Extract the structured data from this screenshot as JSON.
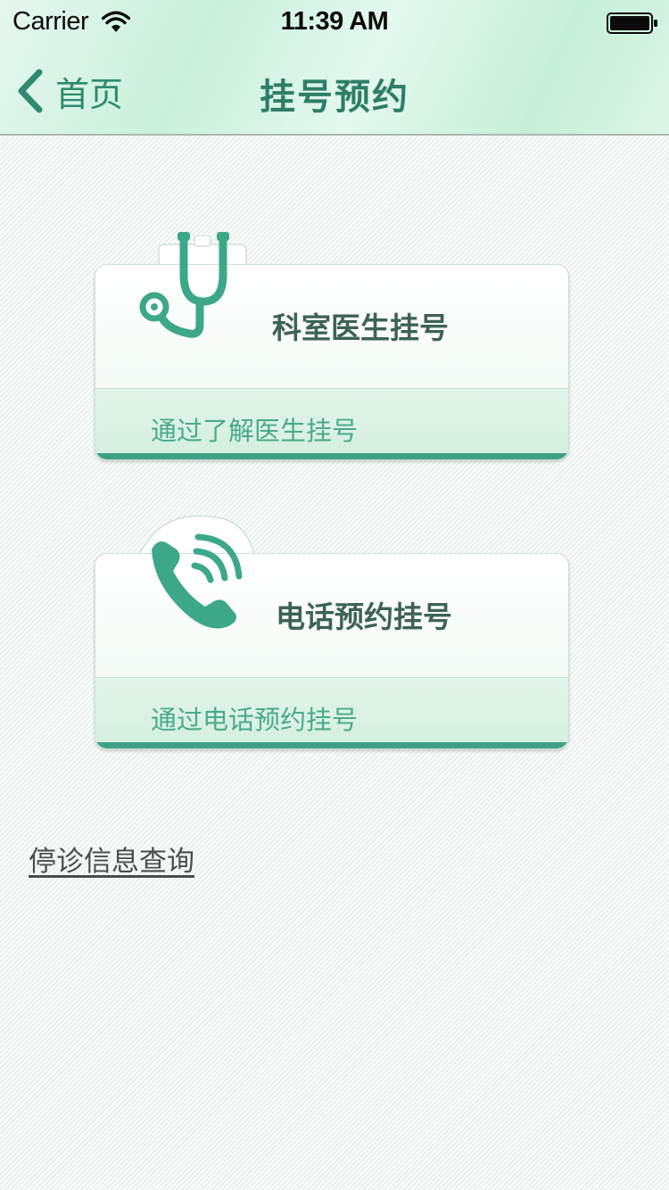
{
  "status_bar": {
    "carrier": "Carrier",
    "time": "11:39 AM"
  },
  "nav": {
    "back_label": "首页",
    "title": "挂号预约"
  },
  "cards": [
    {
      "title": "科室医生挂号",
      "subtitle": "通过了解医生挂号",
      "icon": "stethoscope-icon"
    },
    {
      "title": "电话预约挂号",
      "subtitle": "通过电话预约挂号",
      "icon": "phone-icon"
    }
  ],
  "links": {
    "stop_info": "停诊信息查询"
  },
  "colors": {
    "accent": "#2e8a6c",
    "card_stripe": "#3ea184",
    "header_bg": "#c9f0dd"
  }
}
